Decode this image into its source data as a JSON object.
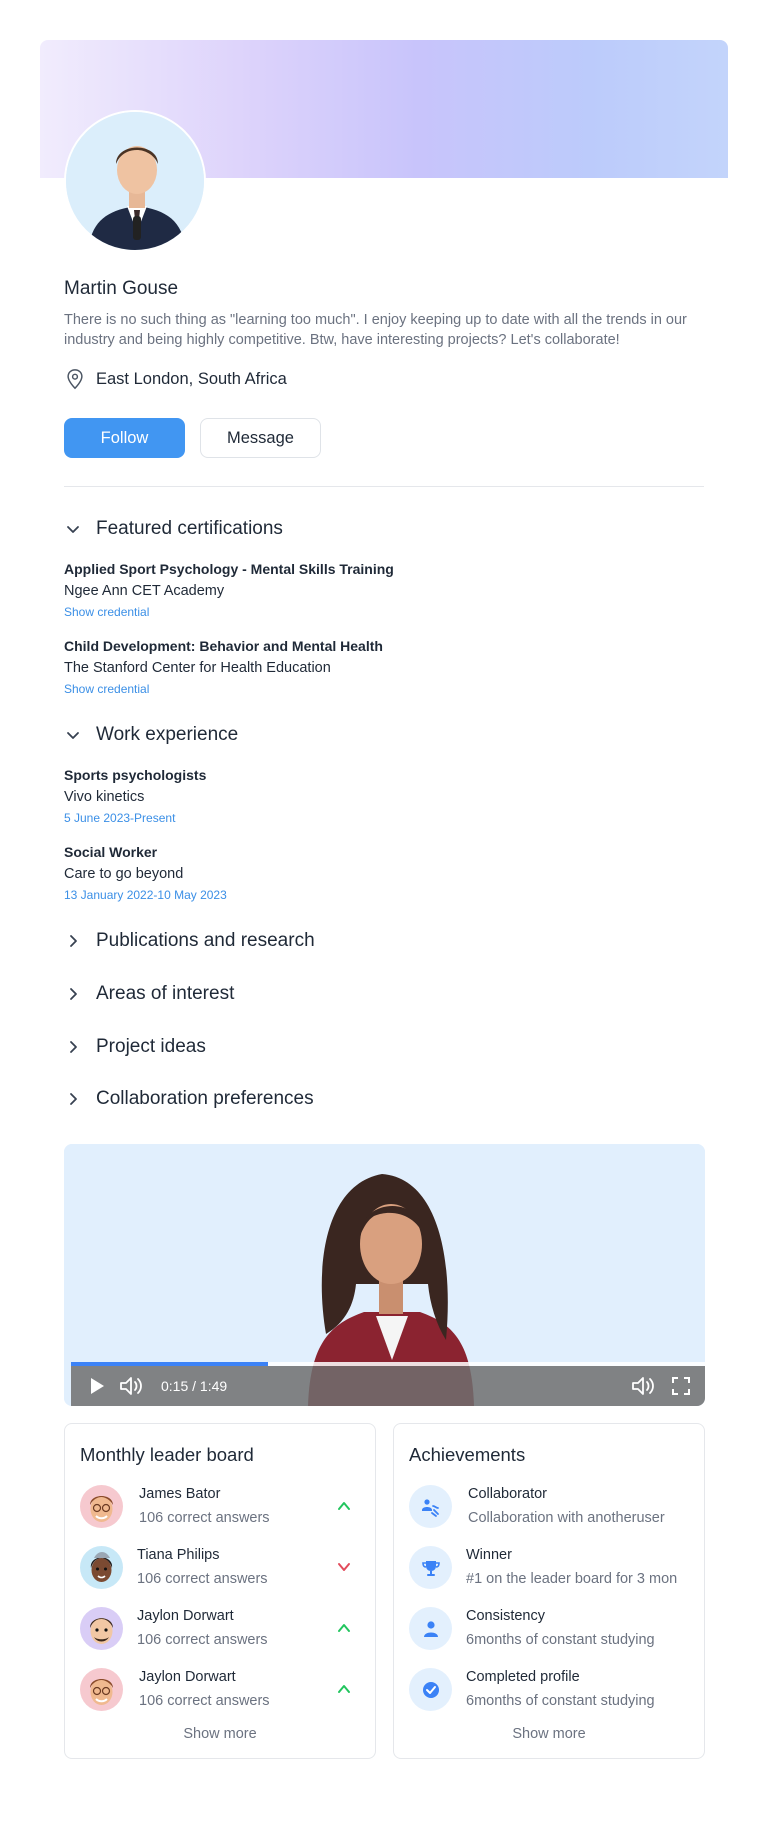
{
  "profile": {
    "name": "Martin Gouse",
    "bio": "There is no such thing as \"learning too much\". I enjoy keeping up to date with all the trends in our industry and being highly competitive. Btw, have interesting projects? Let's collaborate!",
    "location": "East London, South Africa",
    "follow_label": "Follow",
    "message_label": "Message"
  },
  "sections": {
    "certifications": {
      "title": "Featured certifications",
      "items": [
        {
          "title": "Applied Sport Psychology - Mental Skills Training",
          "org": "Ngee Ann CET Academy",
          "link": "Show credential"
        },
        {
          "title": "Child Development: Behavior and Mental Health",
          "org": "The Stanford Center for Health Education",
          "link": "Show credential"
        }
      ]
    },
    "work": {
      "title": "Work experience",
      "items": [
        {
          "title": "Sports psychologists",
          "org": "Vivo kinetics",
          "dates": "5 June 2023-Present"
        },
        {
          "title": "Social Worker",
          "org": "Care to go beyond",
          "dates": "13 January 2022-10 May 2023"
        }
      ]
    },
    "publications": {
      "title": "Publications and research"
    },
    "interests": {
      "title": "Areas of interest"
    },
    "projects": {
      "title": "Project ideas"
    },
    "collaboration": {
      "title": "Collaboration preferences"
    }
  },
  "video": {
    "time": "0:15 / 1:49",
    "progress": 0.31
  },
  "leaderboard": {
    "title": "Monthly leader board",
    "items": [
      {
        "name": "James Bator",
        "sub": "106 correct answers",
        "trend": "up"
      },
      {
        "name": "Tiana Philips",
        "sub": "106 correct answers",
        "trend": "down"
      },
      {
        "name": "Jaylon Dorwart",
        "sub": "106 correct answers",
        "trend": "up"
      },
      {
        "name": "Jaylon Dorwart",
        "sub": "106 correct answers",
        "trend": "up"
      }
    ],
    "show_more": "Show more"
  },
  "achievements": {
    "title": "Achievements",
    "items": [
      {
        "name": "Collaborator",
        "sub": "Collaboration with anotheruser",
        "icon": "collaborator-icon"
      },
      {
        "name": "Winner",
        "sub": "#1 on the leader board for 3 mon",
        "icon": "trophy-icon"
      },
      {
        "name": "Consistency",
        "sub": "6months of constant studying",
        "icon": "person-icon"
      },
      {
        "name": "Completed profile",
        "sub": "6months of constant studying",
        "icon": "check-badge-icon"
      }
    ],
    "show_more": "Show more"
  },
  "colors": {
    "accent": "#4196f2",
    "link": "#3b8fe6",
    "trend_up": "#22c55e",
    "trend_down": "#e24b5b"
  }
}
